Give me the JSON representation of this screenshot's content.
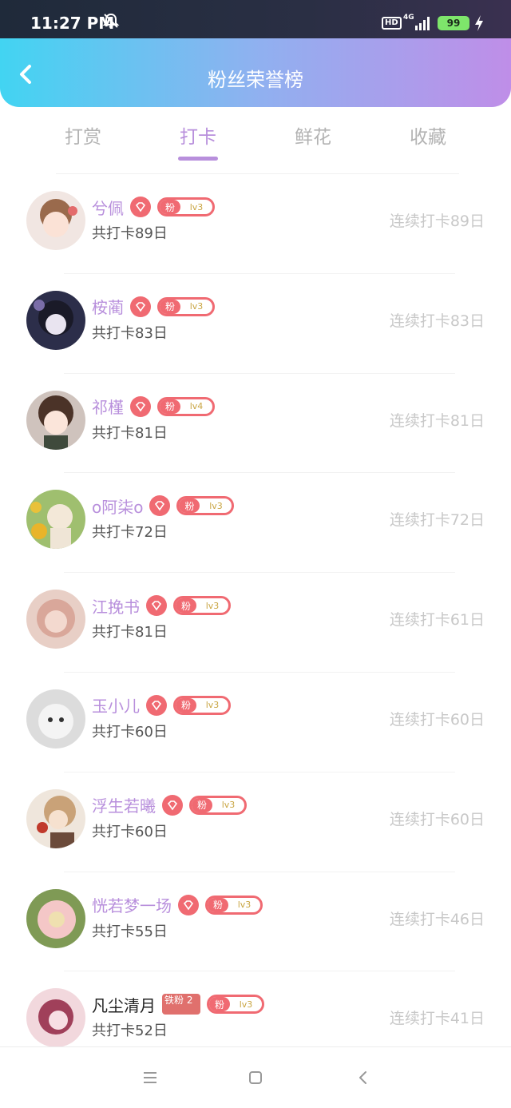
{
  "status_bar": {
    "time": "11:27 PM",
    "hd": "HD",
    "network": "4G",
    "battery": "99"
  },
  "header": {
    "title": "粉丝荣誉榜"
  },
  "tabs": [
    {
      "label": "打赏",
      "active": false
    },
    {
      "label": "打卡",
      "active": true
    },
    {
      "label": "鲜花",
      "active": false
    },
    {
      "label": "收藏",
      "active": false
    }
  ],
  "fans": [
    {
      "name": "兮佩",
      "level": "lv3",
      "fan_tag": "粉",
      "total": "共打卡89日",
      "streak": "连续打卡89日",
      "badge": "gem"
    },
    {
      "name": "桉蔺",
      "level": "lv3",
      "fan_tag": "粉",
      "total": "共打卡83日",
      "streak": "连续打卡83日",
      "badge": "gem"
    },
    {
      "name": "祁槿",
      "level": "lv4",
      "fan_tag": "粉",
      "total": "共打卡81日",
      "streak": "连续打卡81日",
      "badge": "gem"
    },
    {
      "name": "o阿柒o",
      "level": "lv3",
      "fan_tag": "粉",
      "total": "共打卡72日",
      "streak": "连续打卡72日",
      "badge": "gem"
    },
    {
      "name": "江挽书",
      "level": "lv3",
      "fan_tag": "粉",
      "total": "共打卡81日",
      "streak": "连续打卡61日",
      "badge": "gem"
    },
    {
      "name": "玉小儿",
      "level": "lv3",
      "fan_tag": "粉",
      "total": "共打卡60日",
      "streak": "连续打卡60日",
      "badge": "gem"
    },
    {
      "name": "浮生若曦",
      "level": "lv3",
      "fan_tag": "粉",
      "total": "共打卡60日",
      "streak": "连续打卡60日",
      "badge": "gem"
    },
    {
      "name": "恍若梦一场",
      "level": "lv3",
      "fan_tag": "粉",
      "total": "共打卡55日",
      "streak": "连续打卡46日",
      "badge": "gem"
    },
    {
      "name": "凡尘清月",
      "level": "lv3",
      "fan_tag": "粉",
      "total": "共打卡52日",
      "streak": "连续打卡41日",
      "badge": "iron",
      "badge_text": "铁粉 2"
    }
  ],
  "colors": {
    "accent": "#b88fdc",
    "badge_red": "#f06a72",
    "header_start": "#42d4f2",
    "header_end": "#bf8ee8"
  }
}
